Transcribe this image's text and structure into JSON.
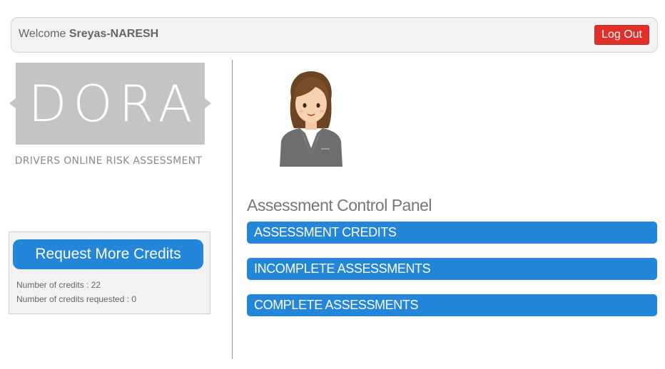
{
  "header": {
    "welcome_prefix": "Welcome",
    "username": "Sreyas-NARESH",
    "logout_label": "Log Out"
  },
  "logo": {
    "text": "DORA",
    "subtitle": "DRIVERS ONLINE RISK ASSESSMENT"
  },
  "credits": {
    "request_button_label": "Request More Credits",
    "credits_line": "Number of credits : 22",
    "requested_line": "Number of credits requested : 0"
  },
  "main": {
    "panel_title": "Assessment Control Panel",
    "menu": [
      {
        "label": "ASSESSMENT CREDITS"
      },
      {
        "label": "INCOMPLETE ASSESSMENTS"
      },
      {
        "label": "COMPLETE ASSESSMENTS"
      }
    ]
  },
  "colors": {
    "accent_blue": "#2386d8",
    "logout_red": "#e1302a",
    "logo_gray": "#c4c4c4"
  },
  "icons": {
    "avatar": "businesswoman-avatar-icon"
  }
}
